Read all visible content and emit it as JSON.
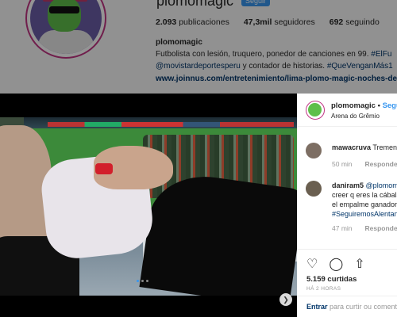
{
  "profile": {
    "username": "plomomagic",
    "follow_label": "Seguir",
    "stats": {
      "posts_count": "2.093",
      "posts_label": "publicaciones",
      "followers_count": "47,3mil",
      "followers_label": "seguidores",
      "following_count": "692",
      "following_label": "seguindo"
    },
    "bio_name": "plomomagic",
    "bio_line1": "Futbolista con lesión, truquero, ponedor de canciones en 99.",
    "bio_line1_tag": "#ElFu",
    "bio_line2_mention": "@movistardeportesperu",
    "bio_line2_text": " y contador de historias. ",
    "bio_line2_tag": "#QueVenganMás1",
    "bio_link": "www.joinnus.com/entretenimiento/lima-plomo-magic-noches-de"
  },
  "post": {
    "username": "plomomagic",
    "separator": "•",
    "follow_label": "Seguir",
    "location": "Arena do Grêmio",
    "comments": [
      {
        "user": "mawacruva",
        "text": "Tremend",
        "time": "50 min",
        "reply": "Responder"
      },
      {
        "user": "daniram5",
        "mention": "@plomom",
        "line2": "creer q eres la cábala",
        "line3": "el empalme ganador",
        "line4": "#SeguiremosAlentan",
        "time": "47 min",
        "reply": "Responder"
      }
    ],
    "likes": "5.159 curtidas",
    "posted_ago": "HÁ 2 HORAS",
    "login_link": "Entrar",
    "login_text": " para curtir ou comenta"
  },
  "media": {
    "next_icon": "chevron-right-icon",
    "dots_count": 3,
    "active_dot": 1
  },
  "colors": {
    "accent_blue": "#3897f0",
    "link_blue": "#003569",
    "ring_magenta": "#c13584"
  }
}
